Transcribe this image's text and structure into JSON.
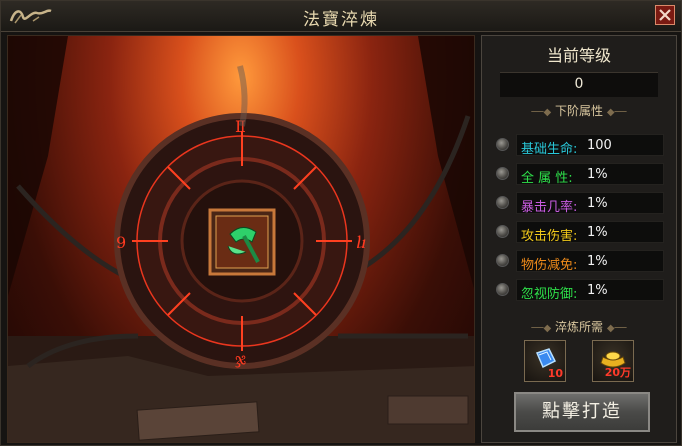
{
  "window": {
    "title": "法寶淬煉",
    "logo_text": "飞鸟",
    "close_icon": "close-icon"
  },
  "panel": {
    "level_header": "当前等级",
    "level_value": "0",
    "next_attr_header": "下阶属性",
    "attributes": [
      {
        "label": "基础生命:",
        "value": "100",
        "color": "#29c7d8"
      },
      {
        "label": "全 属 性:",
        "value": "1%",
        "color": "#2ee04a"
      },
      {
        "label": "暴击几率:",
        "value": "1%",
        "color": "#c85ce0"
      },
      {
        "label": "攻击伤害:",
        "value": "1%",
        "color": "#f0c81a"
      },
      {
        "label": "物伤减免:",
        "value": "1%",
        "color": "#ee8a1a"
      },
      {
        "label": "忽视防御:",
        "value": "1%",
        "color": "#2ee04a"
      }
    ],
    "requirements_header": "淬炼所需",
    "requirements": [
      {
        "icon": "blue-crystal-icon",
        "count": "10"
      },
      {
        "icon": "gold-ingot-icon",
        "count": "20万"
      }
    ],
    "craft_button": "點擊打造"
  },
  "scene": {
    "center_item_icon": "green-axe-icon"
  }
}
